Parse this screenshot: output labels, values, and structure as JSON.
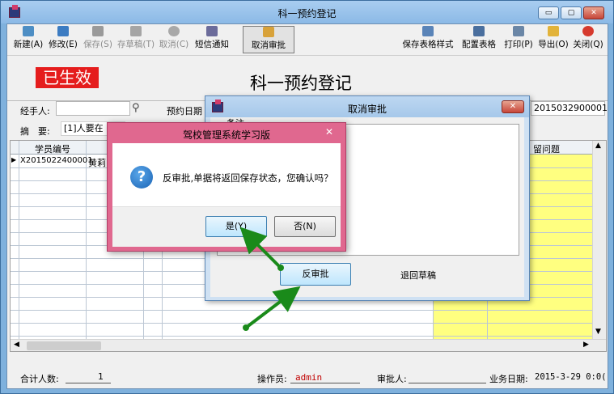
{
  "window": {
    "title": "科一预约登记",
    "min_label": "▭",
    "max_label": "▢",
    "close_label": "✕"
  },
  "toolbar": {
    "left": [
      {
        "label": "新建(A)",
        "icon": "new-icon",
        "state": "enabled"
      },
      {
        "label": "修改(E)",
        "icon": "edit-icon",
        "state": "enabled"
      },
      {
        "label": "保存(S)",
        "icon": "save-icon",
        "state": "disabled"
      },
      {
        "label": "存草稿(T)",
        "icon": "draft-icon",
        "state": "disabled"
      },
      {
        "label": "取消(C)",
        "icon": "cancel-icon",
        "state": "disabled"
      },
      {
        "label": "短信通知",
        "icon": "sms-icon",
        "state": "enabled"
      },
      {
        "label": "取消审批",
        "icon": "unapprove-icon",
        "state": "pressed"
      }
    ],
    "right": [
      {
        "label": "保存表格样式",
        "icon": "save-grid-icon"
      },
      {
        "label": "配置表格",
        "icon": "config-grid-icon"
      },
      {
        "label": "打印(P)",
        "icon": "print-icon"
      },
      {
        "label": "导出(O)",
        "icon": "export-icon"
      },
      {
        "label": "关闭(Q)",
        "icon": "close-icon"
      }
    ]
  },
  "banner": {
    "stamp": "已生效",
    "title": "科一预约登记"
  },
  "form": {
    "agent_label": "经手人:",
    "agent_value": "",
    "date_label": "预约日期",
    "doc_no_suffix": "2015032900001",
    "summary_label": "摘　要:",
    "summary_value": "[1]人要在"
  },
  "grid": {
    "col1_header": "学员编号",
    "last_header": "留问题",
    "rows": [
      {
        "id": "X2015022400001",
        "name": "黄莉"
      }
    ]
  },
  "status": {
    "total_label": "合计人数:",
    "total_value": "1",
    "operator_label": "操作员:",
    "operator_value": "admin",
    "approver_label": "审批人:",
    "approver_value": "",
    "date_label": "业务日期:",
    "date_value": "2015-3-29 0:0("
  },
  "dialog_cancel": {
    "title": "取消审批",
    "memo_label": "备注",
    "unapprove_button": "反审批",
    "return_draft_button": "退回草稿"
  },
  "dialog_confirm": {
    "title": "驾校管理系统学习版",
    "message": "反审批,单据将返回保存状态，您确认吗？",
    "yes_button": "是(Y)",
    "no_button": "否(N)",
    "close_label": "✕"
  },
  "colors": {
    "window_frame": "#7fb1dd",
    "stamp_red": "#e51d1d",
    "grid_yellow": "#ffff80",
    "arrow_green": "#1a8a1a",
    "msgbox_frame": "#e0688f"
  }
}
